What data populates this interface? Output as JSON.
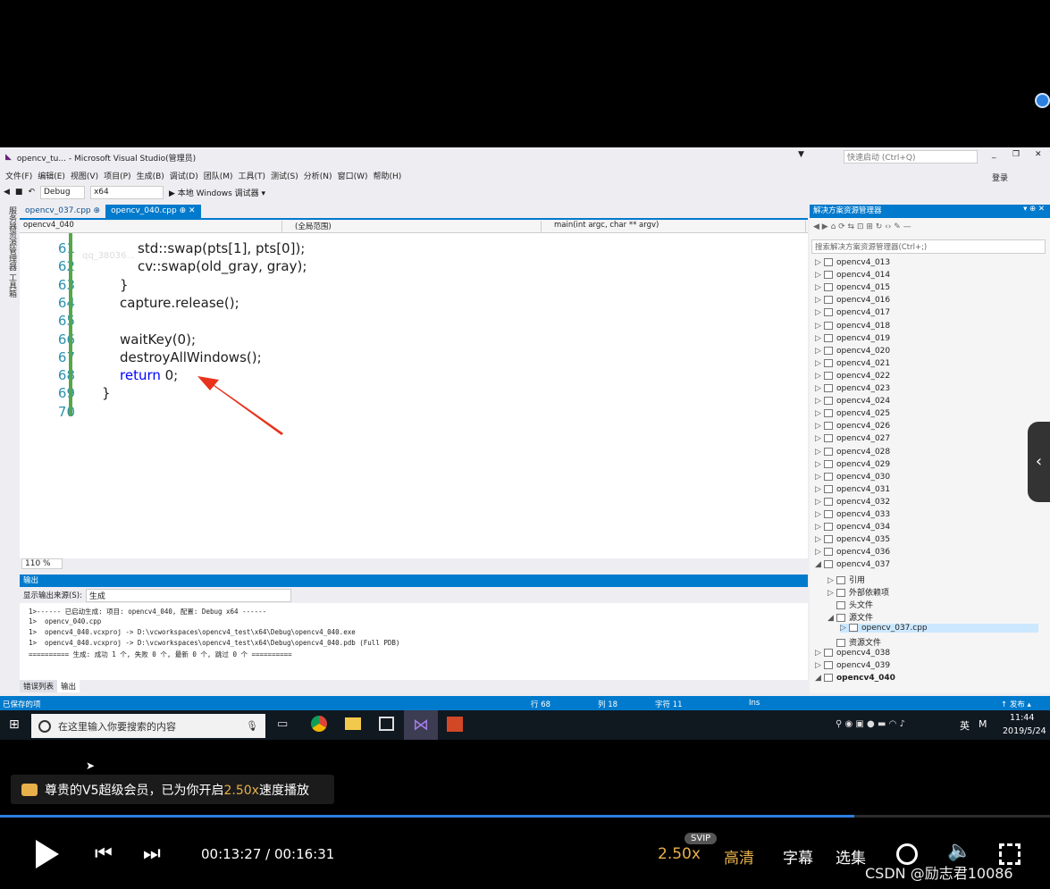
{
  "vs": {
    "title": "opencv_tu... - Microsoft Visual Studio(管理员)",
    "quick_launch": "快速启动 (Ctrl+Q)",
    "login": "登录",
    "menu": [
      "文件(F)",
      "编辑(E)",
      "视图(V)",
      "项目(P)",
      "生成(B)",
      "调试(D)",
      "团队(M)",
      "工具(T)",
      "测试(S)",
      "分析(N)",
      "窗口(W)",
      "帮助(H)"
    ],
    "toolbar": {
      "config": "Debug",
      "platform": "x64",
      "run": "▶ 本地 Windows 调试器 ▾"
    },
    "left_tabs": "服务器资源管理器 工具箱",
    "doc_tabs": [
      {
        "label": "opencv_037.cpp",
        "active": false
      },
      {
        "label": "opencv_040.cpp",
        "active": true
      }
    ],
    "nav": {
      "project": "opencv4_040",
      "scope": "(全局范围)",
      "func": "main(int argc, char ** argv)"
    },
    "watermark": "qq_38036..."
  },
  "code": [
    {
      "n": "61",
      "indent": 2,
      "text": "std::swap(pts[1], pts[0]);"
    },
    {
      "n": "62",
      "indent": 2,
      "text": "cv::swap(old_gray, gray);"
    },
    {
      "n": "63",
      "indent": 1,
      "text": "}"
    },
    {
      "n": "64",
      "indent": 1,
      "text": "capture.release();"
    },
    {
      "n": "65",
      "indent": 1,
      "text": ""
    },
    {
      "n": "66",
      "indent": 1,
      "text": "waitKey(0);"
    },
    {
      "n": "67",
      "indent": 1,
      "text": "destroyAllWindows();"
    },
    {
      "n": "68",
      "indent": 1,
      "kw": "return",
      "text": " 0;"
    },
    {
      "n": "69",
      "indent": 0,
      "text": "}"
    },
    {
      "n": "70",
      "indent": 0,
      "text": ""
    }
  ],
  "zoom": "110 %",
  "output": {
    "title": "输出",
    "source_label": "显示输出来源(S):",
    "source_value": "生成",
    "lines": [
      "1>------ 已启动生成: 项目: opencv4_040, 配置: Debug x64 ------",
      "1>  opencv_040.cpp",
      "1>  opencv4_040.vcxproj -> D:\\vcworkspaces\\opencv4_test\\x64\\Debug\\opencv4_040.exe",
      "1>  opencv4_040.vcxproj -> D:\\vcworkspaces\\opencv4_test\\x64\\Debug\\opencv4_040.pdb (Full PDB)",
      "========== 生成: 成功 1 个, 失败 0 个, 最新 0 个, 跳过 0 个 =========="
    ],
    "tabs": [
      "错误列表",
      "输出"
    ]
  },
  "solution": {
    "title": "解决方案资源管理器",
    "search": "搜索解决方案资源管理器(Ctrl+;)",
    "items": [
      {
        "label": "opencv4_013",
        "level": 0,
        "arrow": "▷"
      },
      {
        "label": "opencv4_014",
        "level": 0,
        "arrow": "▷"
      },
      {
        "label": "opencv4_015",
        "level": 0,
        "arrow": "▷"
      },
      {
        "label": "opencv4_016",
        "level": 0,
        "arrow": "▷"
      },
      {
        "label": "opencv4_017",
        "level": 0,
        "arrow": "▷"
      },
      {
        "label": "opencv4_018",
        "level": 0,
        "arrow": "▷"
      },
      {
        "label": "opencv4_019",
        "level": 0,
        "arrow": "▷"
      },
      {
        "label": "opencv4_020",
        "level": 0,
        "arrow": "▷"
      },
      {
        "label": "opencv4_021",
        "level": 0,
        "arrow": "▷"
      },
      {
        "label": "opencv4_022",
        "level": 0,
        "arrow": "▷"
      },
      {
        "label": "opencv4_023",
        "level": 0,
        "arrow": "▷"
      },
      {
        "label": "opencv4_024",
        "level": 0,
        "arrow": "▷"
      },
      {
        "label": "opencv4_025",
        "level": 0,
        "arrow": "▷"
      },
      {
        "label": "opencv4_026",
        "level": 0,
        "arrow": "▷"
      },
      {
        "label": "opencv4_027",
        "level": 0,
        "arrow": "▷"
      },
      {
        "label": "opencv4_028",
        "level": 0,
        "arrow": "▷"
      },
      {
        "label": "opencv4_029",
        "level": 0,
        "arrow": "▷"
      },
      {
        "label": "opencv4_030",
        "level": 0,
        "arrow": "▷"
      },
      {
        "label": "opencv4_031",
        "level": 0,
        "arrow": "▷"
      },
      {
        "label": "opencv4_032",
        "level": 0,
        "arrow": "▷"
      },
      {
        "label": "opencv4_033",
        "level": 0,
        "arrow": "▷"
      },
      {
        "label": "opencv4_034",
        "level": 0,
        "arrow": "▷"
      },
      {
        "label": "opencv4_035",
        "level": 0,
        "arrow": "▷"
      },
      {
        "label": "opencv4_036",
        "level": 0,
        "arrow": "▷"
      },
      {
        "label": "opencv4_037",
        "level": 0,
        "arrow": "◢"
      },
      {
        "label": "引用",
        "level": 1,
        "arrow": "▷"
      },
      {
        "label": "外部依赖项",
        "level": 1,
        "arrow": "▷"
      },
      {
        "label": "头文件",
        "level": 1,
        "arrow": ""
      },
      {
        "label": "源文件",
        "level": 1,
        "arrow": "◢"
      },
      {
        "label": "opencv_037.cpp",
        "level": 2,
        "arrow": "▷",
        "selected": true
      },
      {
        "label": "资源文件",
        "level": 1,
        "arrow": ""
      },
      {
        "label": "opencv4_038",
        "level": 0,
        "arrow": "▷"
      },
      {
        "label": "opencv4_039",
        "level": 0,
        "arrow": "▷"
      },
      {
        "label": "opencv4_040",
        "level": 0,
        "arrow": "◢",
        "bold": true
      }
    ]
  },
  "status": {
    "left": "已保存的项",
    "row": "行 68",
    "col": "列 18",
    "char": "字符 11",
    "mode": "Ins",
    "publish": "↑ 发布 ▴"
  },
  "taskbar": {
    "search": "在这里输入你要搜索的内容",
    "time": "11:44",
    "date": "2019/5/24",
    "lang": "英"
  },
  "player": {
    "vip_msg_prefix": "尊贵的V5超级会员，已为你开启",
    "vip_speed": "2.50x",
    "vip_msg_suffix": "速度播放",
    "time": "00:13:27 / 00:16:31",
    "progress": 0.814,
    "speed": "2.50x",
    "svip": "SVIP",
    "quality": "高清",
    "subtitle": "字幕",
    "episodes": "选集",
    "watermark": "CSDN @励志君10086"
  }
}
